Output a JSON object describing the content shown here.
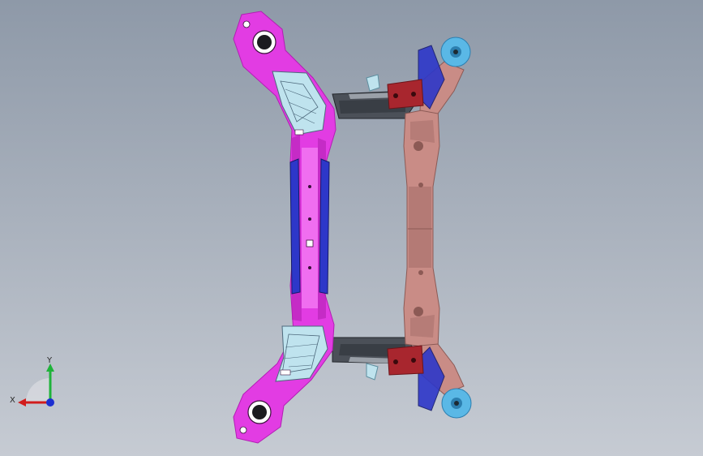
{
  "viewport": {
    "background_top": "#8e99a8",
    "background_bottom": "#c6cbd3"
  },
  "model": {
    "colors": {
      "front_crossmember": "#e23ce3",
      "front_crossmember_dark": "#b21fb3",
      "front_reinforcement": "#2d37c9",
      "rear_beam": "#c98c86",
      "rear_beam_dark": "#8c5a55",
      "bracket": "#a8262e",
      "bracket_dark": "#6b1419",
      "link_arm": "#4b5058",
      "bushing": "#5ab8e6",
      "bushing_dark": "#2c7fb0",
      "detail_cyan": "#bfe3ee"
    }
  },
  "triad": {
    "x_label": "X",
    "y_label": "Y",
    "colors": {
      "x": "#d11c1c",
      "y": "#1fb33a",
      "z": "#1c2fd1"
    }
  }
}
